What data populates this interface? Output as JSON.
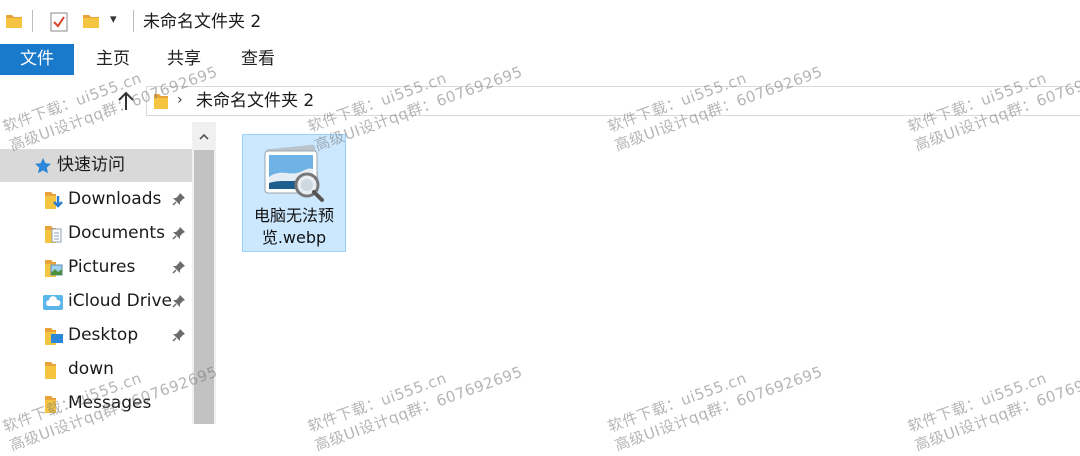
{
  "window": {
    "title": "未命名文件夹 2",
    "quick_access_dropdown": "▾"
  },
  "ribbon": {
    "tabs": [
      {
        "label": "文件",
        "active": true
      },
      {
        "label": "主页"
      },
      {
        "label": "共享"
      },
      {
        "label": "查看"
      }
    ]
  },
  "address_bar": {
    "path": "未命名文件夹 2",
    "separator": "›"
  },
  "nav_pane": {
    "quick_access_label": "快速访问",
    "items": [
      {
        "label": "Downloads",
        "icon": "downloads-folder-icon",
        "pinned": true
      },
      {
        "label": "Documents",
        "icon": "documents-folder-icon",
        "pinned": true
      },
      {
        "label": "Pictures",
        "icon": "pictures-folder-icon",
        "pinned": true
      },
      {
        "label": "iCloud Drive",
        "icon": "icloud-folder-icon",
        "pinned": true
      },
      {
        "label": "Desktop",
        "icon": "desktop-folder-icon",
        "pinned": true
      },
      {
        "label": "down",
        "icon": "folder-icon",
        "pinned": false
      },
      {
        "label": "Messages",
        "icon": "folder-icon",
        "pinned": false
      }
    ]
  },
  "files": [
    {
      "name": "电脑无法预览.webp",
      "selected": true,
      "icon": "image-preview-icon"
    }
  ],
  "watermark": {
    "line1": "软件下载：ui555.cn",
    "line2": "高级UI设计qq群：607692695"
  },
  "colors": {
    "file_tab_bg": "#1979ca",
    "selection_bg": "#cce8ff",
    "quick_access_bg": "#d9d9d9",
    "folder_yellow": "#f5c542"
  }
}
